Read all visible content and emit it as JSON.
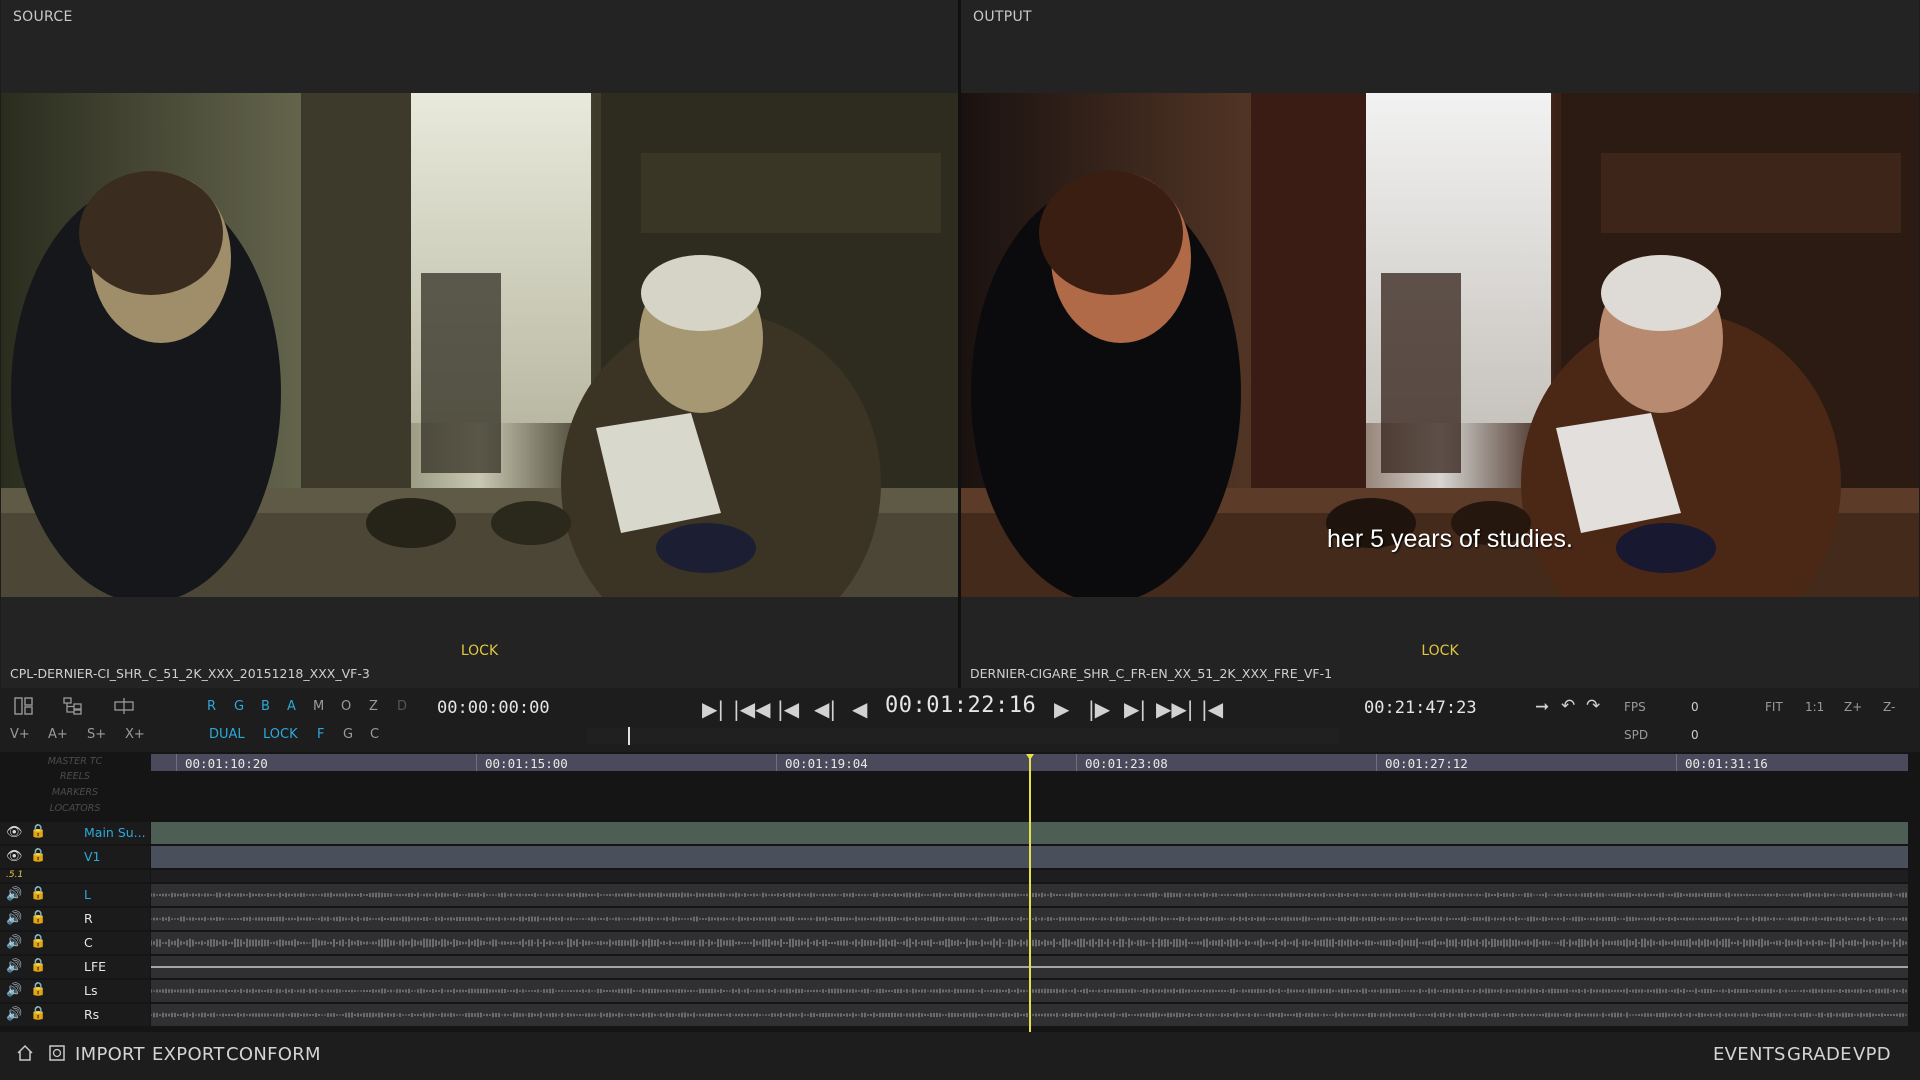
{
  "viewers": {
    "source": {
      "title": "SOURCE",
      "lock": "LOCK",
      "clip": "CPL-DERNIER-CI_SHR_C_51_2K_XXX_20151218_XXX_VF-3"
    },
    "output": {
      "title": "OUTPUT",
      "lock": "LOCK",
      "clip": "DERNIER-CIGARE_SHR_C_FR-EN_XX_51_2K_XXX_FRE_VF-1",
      "subtitle": "her 5 years of studies."
    }
  },
  "toolbar": {
    "channels": [
      "R",
      "G",
      "B",
      "A",
      "M",
      "O",
      "Z",
      "D"
    ],
    "add_buttons": [
      "V+",
      "A+",
      "S+",
      "X+"
    ],
    "modes": [
      "DUAL",
      "LOCK",
      "F",
      "G",
      "C"
    ],
    "timecode_in": "00:00:00:00",
    "timecode_current": "00:01:22:16",
    "timecode_duration": "00:21:47:23",
    "fps_label": "FPS",
    "fps_value": "0",
    "spd_label": "SPD",
    "spd_value": "0",
    "zoom_buttons": [
      "FIT",
      "1:1",
      "Z+",
      "Z-"
    ]
  },
  "timeline": {
    "ruler_labels": [
      "MASTER TC",
      "REELS",
      "MARKERS",
      "LOCATORS"
    ],
    "ruler_times": [
      "00:01:10:20",
      "00:01:15:00",
      "00:01:19:04",
      "00:01:23:08",
      "00:01:27:12",
      "00:01:31:16"
    ],
    "video_tracks": [
      {
        "name": "Main Su...",
        "color": "#4d5f55"
      },
      {
        "name": "V1",
        "color": "#4a4f5c"
      }
    ],
    "audio_group": ".5.1",
    "audio_tracks": [
      "L",
      "R",
      "C",
      "LFE",
      "Ls",
      "Rs"
    ]
  },
  "nav": {
    "left": [
      "IMPORT",
      "EXPORT",
      "CONFORM"
    ],
    "right": [
      "EVENTS",
      "GRADE",
      "VPD"
    ]
  }
}
